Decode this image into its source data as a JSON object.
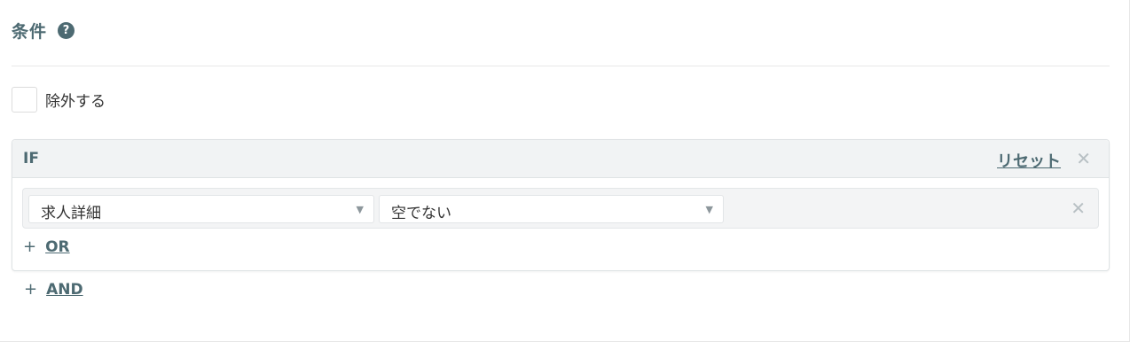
{
  "condition_section": {
    "title": "条件",
    "help_icon": "question-circle-icon",
    "help_glyph": "?"
  },
  "exclude": {
    "label": "除外する",
    "checked": false
  },
  "if_block": {
    "label": "IF",
    "reset_label": "リセット",
    "close_glyph": "✕",
    "condition": {
      "field_value": "求人詳細",
      "operator_value": "空でない",
      "caret_glyph": "▼",
      "remove_glyph": "✕"
    },
    "add_or": {
      "plus": "+",
      "label": "OR"
    }
  },
  "add_and": {
    "plus": "+",
    "label": "AND"
  },
  "colors": {
    "accent": "#4d6a72",
    "header_bg": "#f1f3f4",
    "row_bg": "#f3f4f5"
  }
}
